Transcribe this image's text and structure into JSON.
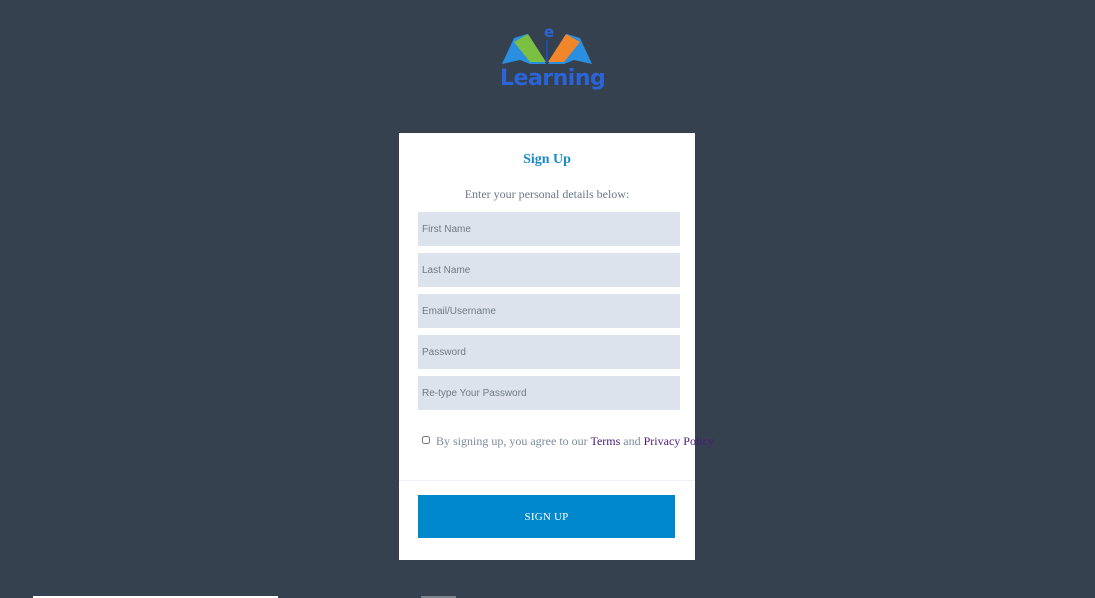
{
  "logo": {
    "letter": "e",
    "text": "Learning"
  },
  "form": {
    "title": "Sign Up",
    "subtitle": "Enter your personal details below:",
    "fields": [
      {
        "placeholder": "First Name",
        "value": ""
      },
      {
        "placeholder": "Last Name",
        "value": ""
      },
      {
        "placeholder": "Email/Username",
        "value": ""
      },
      {
        "placeholder": "Password",
        "value": ""
      },
      {
        "placeholder": "Re-type Your Password",
        "value": ""
      }
    ],
    "terms": {
      "prefix": "By signing up, you agree to our",
      "terms_link": "Terms",
      "connector": "and",
      "privacy_link": "Privacy Policy",
      "checked": false
    },
    "submit_label": "SIGN UP"
  },
  "colors": {
    "background": "#364150",
    "title": "#1a8ac6",
    "button": "#0088cc",
    "field": "#dde3ec",
    "link": "#4a1a78"
  }
}
